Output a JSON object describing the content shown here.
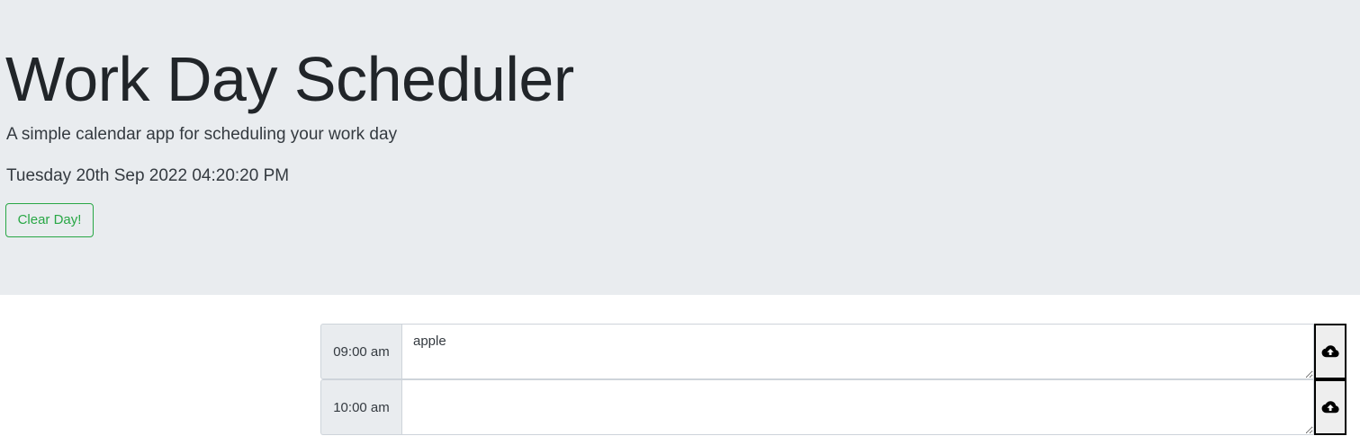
{
  "header": {
    "title": "Work Day Scheduler",
    "subtitle": "A simple calendar app for scheduling your work day",
    "current_datetime": "Tuesday 20th Sep 2022 04:20:20 PM",
    "clear_button_label": "Clear Day!"
  },
  "rows": [
    {
      "hour": "09:00 am",
      "text": "apple",
      "save_icon": "cloud-upload-icon"
    },
    {
      "hour": "10:00 am",
      "text": "",
      "save_icon": "cloud-upload-icon"
    }
  ],
  "colors": {
    "jumbotron_bg": "#e9ecef",
    "clear_button": "#28a745",
    "hour_bg": "#e9ecef",
    "save_bg": "#eeeeee",
    "save_border": "#000000"
  }
}
